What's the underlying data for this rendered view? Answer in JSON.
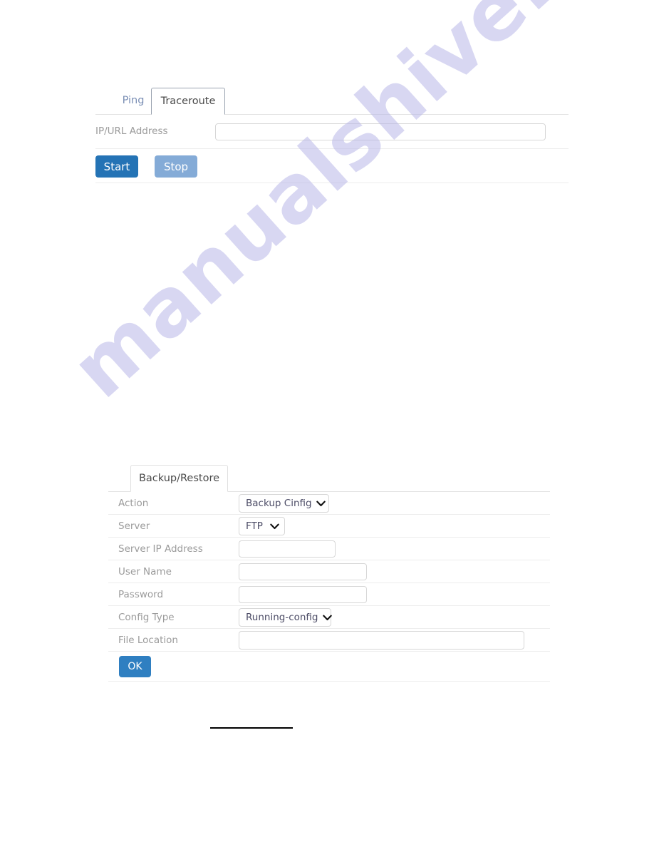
{
  "watermark": {
    "text": "manualshive.com"
  },
  "diagnostics_panel": {
    "tabs": [
      {
        "label": "Ping",
        "active": false
      },
      {
        "label": "Traceroute",
        "active": true
      }
    ],
    "fields": [
      {
        "label": "IP/URL Address",
        "value": "",
        "placeholder": ""
      }
    ],
    "buttons": [
      {
        "label": "Start",
        "color": "#2473b5"
      },
      {
        "label": "Stop",
        "color": "#84abd7"
      }
    ]
  },
  "backup_panel": {
    "tabs": [
      {
        "label": "Backup/Restore",
        "active": true
      }
    ],
    "rows": [
      {
        "label": "Action",
        "control": "select",
        "value": "Backup Cinfig"
      },
      {
        "label": "Server",
        "control": "select",
        "value": "FTP"
      },
      {
        "label": "Server IP Address",
        "control": "text",
        "value": ""
      },
      {
        "label": "User Name",
        "control": "text",
        "value": ""
      },
      {
        "label": "Password",
        "control": "text",
        "value": ""
      },
      {
        "label": "Config Type",
        "control": "select",
        "value": "Running-config"
      },
      {
        "label": "File Location",
        "control": "text",
        "value": ""
      }
    ],
    "buttons": [
      {
        "label": "OK",
        "color": "#2f7fc1"
      }
    ]
  },
  "icons": {
    "chevron_down": "chevron-down-icon"
  }
}
